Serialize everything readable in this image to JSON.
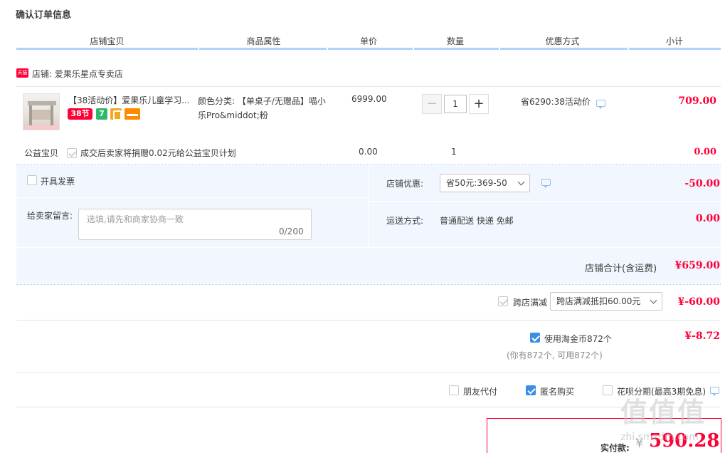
{
  "page_title": "确认订单信息",
  "columns": [
    "店铺宝贝",
    "商品属性",
    "单价",
    "数量",
    "优惠方式",
    "小计"
  ],
  "shop": {
    "badge": "天猫",
    "label": "店铺: 爱果乐星点专卖店"
  },
  "item": {
    "title": "【38活动价】爱果乐儿童学习...",
    "badges": [
      "38节",
      "7"
    ],
    "attr": "颜色分类: 【单桌子/无赠品】喵小乐Pro&middot;粉",
    "price": "6999.00",
    "qty_minus": "−",
    "qty_value": "1",
    "qty_plus": "+",
    "discount": "省6290:38活动价",
    "subtotal": "709.00"
  },
  "charity": {
    "label": "公益宝贝",
    "text": "成交后卖家将捐赠0.02元给公益宝贝计划",
    "price": "0.00",
    "qty": "1",
    "subtotal": "0.00"
  },
  "invoice": {
    "label": "开具发票"
  },
  "message": {
    "label": "给卖家留言:",
    "placeholder": "选填,请先和商家协商一致",
    "count": "0/200"
  },
  "shop_discount": {
    "label": "店铺优惠:",
    "selected": "省50元:369-50",
    "amount": "-50.00"
  },
  "shipping": {
    "label": "运送方式:",
    "value": "普通配送 快递 免邮",
    "amount": "0.00"
  },
  "shop_total": {
    "label": "店铺合计(含运费)",
    "amount": "¥659.00"
  },
  "cross_shop": {
    "label": "跨店满减",
    "selected": "跨店满减抵扣60.00元",
    "amount": "¥-60.00"
  },
  "taobao_coin": {
    "label": "使用淘金币872个",
    "note": "(你有872个, 可用872个)",
    "amount": "¥-8.72"
  },
  "options": {
    "friend_pay": "朋友代付",
    "anonymous": "匿名购买",
    "huabei": "花呗分期(最高3期免息)"
  },
  "payment": {
    "label": "实付款:",
    "currency": "¥",
    "amount": "590.28"
  },
  "watermark": {
    "logo": "值值值",
    "url": "zhi.smzdm.com"
  },
  "colors": {
    "accent_red": "#ff0036",
    "header_line": "#b2d1ff",
    "panel_bg": "#f2f7ff",
    "checkbox_blue": "#3a8ee6"
  }
}
